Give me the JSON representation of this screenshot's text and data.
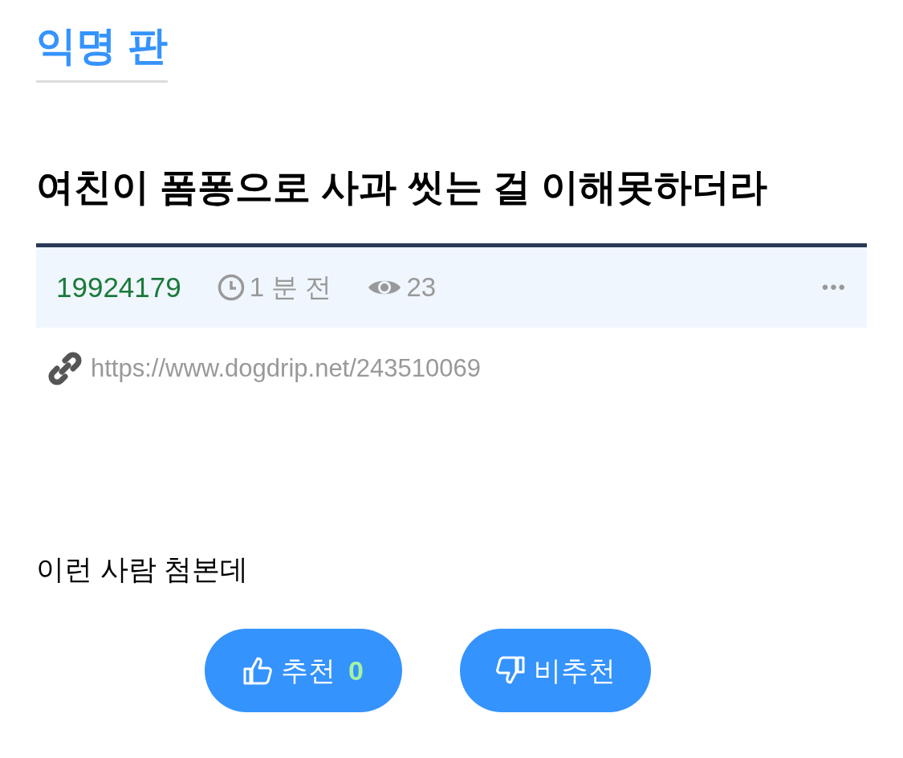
{
  "board": {
    "title": "익명 판"
  },
  "post": {
    "title": "여친이 폼퐁으로 사과 씻는 걸 이해못하더라",
    "author": "19924179",
    "time": "1 분 전",
    "views": "23",
    "more": "•••",
    "url": "https://www.dogdrip.net/243510069",
    "body": "이런 사람 첨본데"
  },
  "votes": [
    {
      "kind": "up",
      "label": "추천",
      "count": "0"
    },
    {
      "kind": "down",
      "label": "비추천"
    }
  ]
}
